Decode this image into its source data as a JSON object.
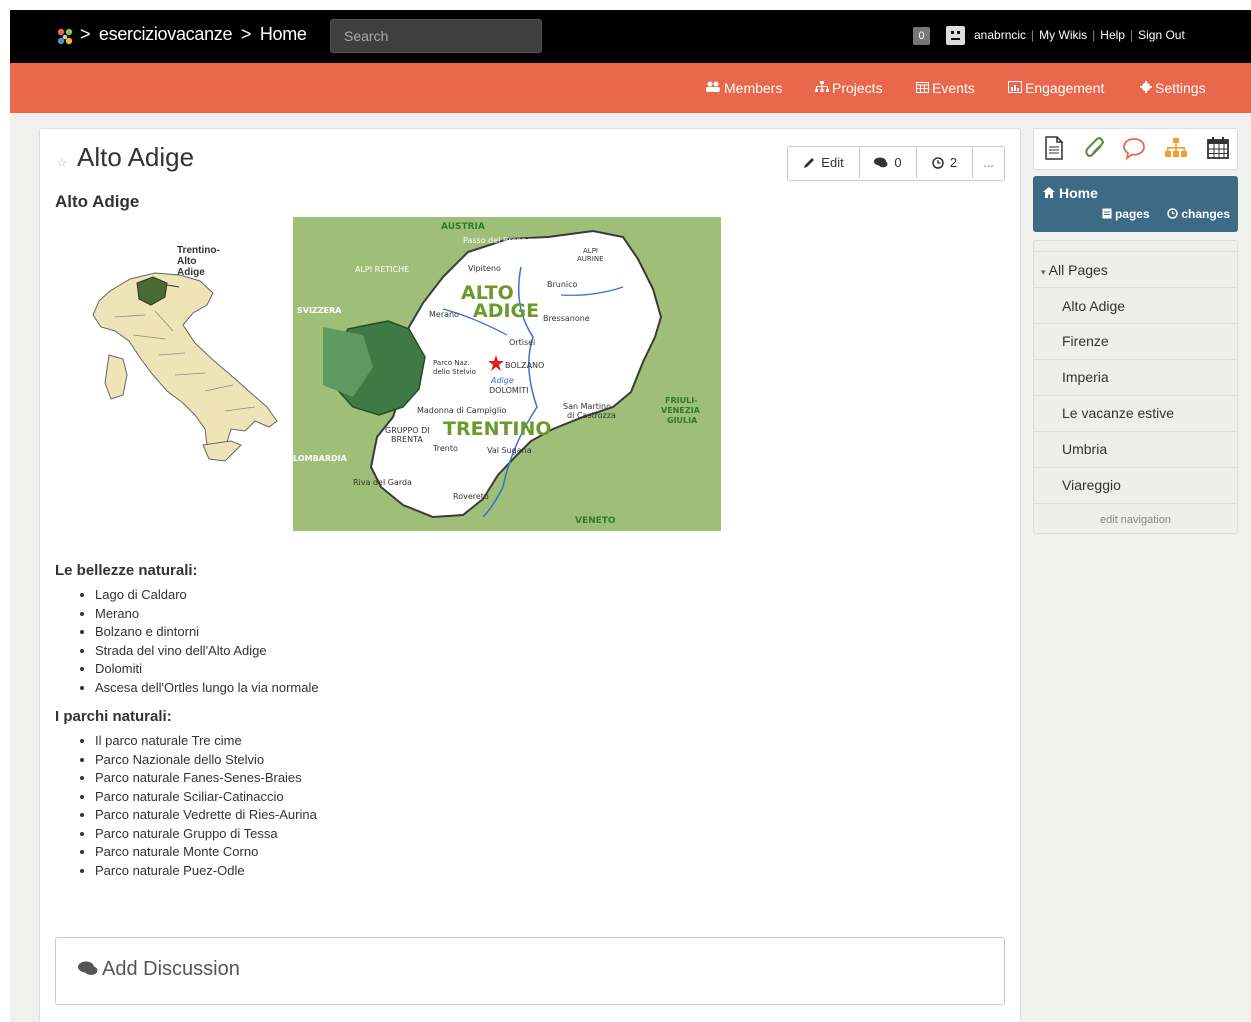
{
  "topbar": {
    "breadcrumb_sep1": ">",
    "wiki": "eserciziovacanze",
    "breadcrumb_sep2": ">",
    "page": "Home",
    "search_placeholder": "Search",
    "notification_count": "0",
    "user": "anabrncic",
    "my_wikis": "My Wikis",
    "help": "Help",
    "sign_out": "Sign Out",
    "sep": "|"
  },
  "nav": {
    "members": "Members",
    "projects": "Projects",
    "events": "Events",
    "engagement": "Engagement",
    "settings": "Settings"
  },
  "page": {
    "title": "Alto Adige",
    "edit_label": "Edit",
    "comments_count": "0",
    "history_count": "2",
    "more_label": "...",
    "subtitle": "Alto Adige",
    "italy_map_label": "Trentino-Alto Adige",
    "region_map": {
      "labels": [
        "AUSTRIA",
        "ALTO",
        "ADIGE",
        "TRENTINO",
        "SVIZZERA",
        "LOMBARDIA",
        "VENETO",
        "FRIULI-",
        "VENEZIA",
        "GIULIA",
        "BOLZANO",
        "Merano",
        "Bressanone",
        "Brunico",
        "Vipiteno",
        "Trento",
        "Rovereto",
        "Riva del Garda",
        "Ortisei",
        "Val Sugana",
        "DOLOMITI",
        "ALPI RETICHE",
        "ALPI AURINE",
        "Madonna di Campiglio",
        "San Martino di Castrozza",
        "GRUPPO DI BRENTA",
        "Adige",
        "Passo del Brennero",
        "Parco Naz. dello Stelvio"
      ]
    },
    "section1_title": "Le bellezze naturali:",
    "section1_items": [
      "Lago di Caldaro",
      "Merano",
      "Bolzano e dintorni",
      "Strada del vino dell'Alto Adige",
      "Dolomiti",
      "Ascesa dell'Ortles lungo la via normale"
    ],
    "section2_title": "I parchi naturali:",
    "section2_items": [
      "Il parco naturale Tre cime",
      "Parco Nazionale dello Stelvio",
      "Parco naturale Fanes-Senes-Braies",
      "Parco naturale Sciliar-Catinaccio",
      "Parco naturale Vedrette di Ries-Aurina",
      "Parco naturale Gruppo di Tessa",
      "Parco naturale Monte Corno",
      "Parco naturale Puez-Odle"
    ],
    "add_discussion": "Add Discussion"
  },
  "sidebar": {
    "home": "Home",
    "pages_link": "pages",
    "changes_link": "changes",
    "all_pages": "All Pages",
    "items": [
      "Alto Adige",
      "Firenze",
      "Imperia",
      "Le vacanze estive",
      "Umbria",
      "Viareggio"
    ],
    "edit_navigation": "edit navigation"
  },
  "colors": {
    "accent": "#e8674d",
    "topbar": "#000000",
    "home_box": "#3d6b86",
    "icon_orange": "#e8674d",
    "icon_green": "#5a8a3a"
  },
  "icons": {
    "logo": "pinwheel-logo",
    "members": "users-icon",
    "projects": "sitemap-icon",
    "events": "calendar-icon",
    "engagement": "chart-icon",
    "settings": "gear-icon",
    "edit": "pencil-icon",
    "comments": "comments-icon",
    "history": "clock-icon",
    "star": "star-icon",
    "toolbar": [
      "page-icon",
      "paperclip-icon",
      "speech-bubble-icon",
      "sitemap-icon",
      "calendar-icon"
    ],
    "home": "home-icon",
    "pages": "file-icon",
    "changes": "clock-icon",
    "all_pages_caret": "caret-down-icon",
    "discussion": "comments-icon"
  }
}
